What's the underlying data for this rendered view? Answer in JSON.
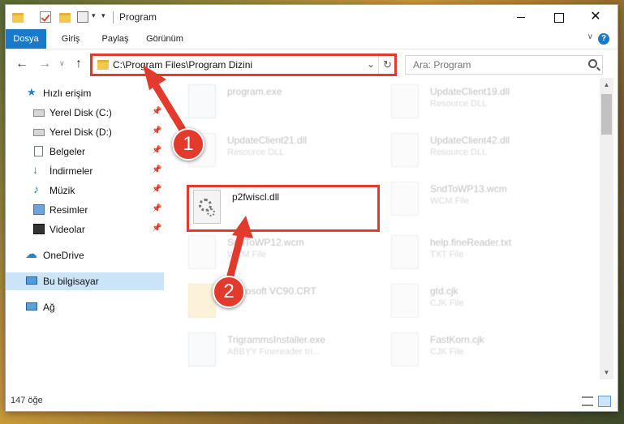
{
  "window": {
    "title": "Program"
  },
  "ribbon": {
    "tabs": [
      {
        "label": "Dosya",
        "active": true
      },
      {
        "label": "Giriş"
      },
      {
        "label": "Paylaş"
      },
      {
        "label": "Görünüm"
      }
    ]
  },
  "address": {
    "path": "C:\\Program Files\\Program Dizini"
  },
  "search": {
    "placeholder": "Ara: Program"
  },
  "sidebar": {
    "items": [
      {
        "label": "Hızlı erişim",
        "icon": "star-icon"
      },
      {
        "label": "Yerel Disk (C:)",
        "icon": "disk-icon",
        "pinned": true
      },
      {
        "label": "Yerel Disk (D:)",
        "icon": "disk-icon",
        "pinned": true
      },
      {
        "label": "Belgeler",
        "icon": "documents-icon",
        "pinned": true
      },
      {
        "label": "İndirmeler",
        "icon": "downloads-icon",
        "pinned": true
      },
      {
        "label": "Müzik",
        "icon": "music-icon",
        "pinned": true
      },
      {
        "label": "Resimler",
        "icon": "pictures-icon",
        "pinned": true
      },
      {
        "label": "Videolar",
        "icon": "videos-icon",
        "pinned": true
      },
      {
        "label": "OneDrive",
        "icon": "cloud-icon"
      },
      {
        "label": "Bu bilgisayar",
        "icon": "computer-icon",
        "selected": true
      },
      {
        "label": "Ağ",
        "icon": "network-icon"
      }
    ]
  },
  "files": [
    {
      "name": "program.exe",
      "type": ""
    },
    {
      "name": "UpdateClient19.dll",
      "type": "Resource DLL"
    },
    {
      "name": "UpdateClient21.dll",
      "type": "Resource DLL"
    },
    {
      "name": "UpdateClient42.dll",
      "type": "Resource DLL"
    },
    {
      "name": "p2fwiscl.dll",
      "type": ""
    },
    {
      "name": "SndToWP13.wcm",
      "type": "WCM File"
    },
    {
      "name": "SndToWP12.wcm",
      "type": "WCM File"
    },
    {
      "name": "help.fineReader.txt",
      "type": "TXT File"
    },
    {
      "name": "Microsoft VC90.CRT",
      "type": ""
    },
    {
      "name": "gtd.cjk",
      "type": "CJK File"
    },
    {
      "name": "TrigrammsInstaller.exe",
      "type": "ABBYY Finereader tri..."
    },
    {
      "name": "FastKorn.cjk",
      "type": "CJK File"
    }
  ],
  "status": {
    "count": "147 öğe"
  },
  "steps": {
    "one": "1",
    "two": "2"
  },
  "colors": {
    "accent": "#1979ca",
    "annotation": "#e23b2e",
    "selection": "#cce4f7"
  }
}
